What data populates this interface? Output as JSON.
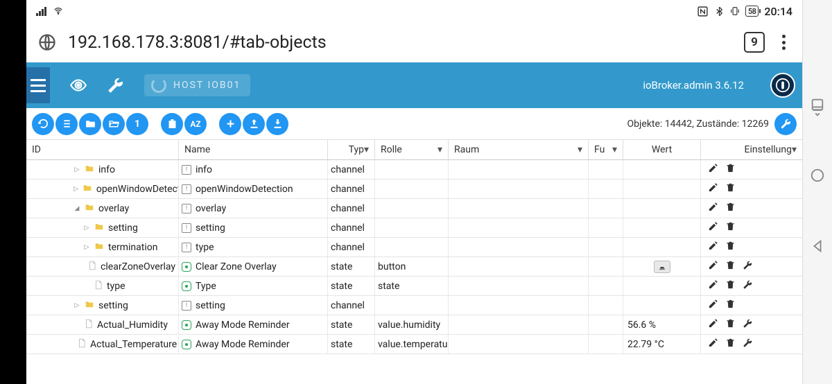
{
  "status_bar": {
    "battery": "58",
    "time": "20:14"
  },
  "browser": {
    "url": "192.168.178.3:8081/#tab-objects",
    "tab_count": "9"
  },
  "app_header": {
    "host_label": "HOST IOB01",
    "title": "ioBroker.admin 3.6.12"
  },
  "toolbar": {
    "az_label": "AZ",
    "one_label": "1",
    "count_text": "Objekte: 14442, Zustände: 12269"
  },
  "columns": {
    "id": "ID",
    "name": "Name",
    "typ": "Typ",
    "rolle": "Rolle",
    "raum": "Raum",
    "funktion": "Fu",
    "wert": "Wert",
    "einstellung": "Einstellung"
  },
  "rows": [
    {
      "indent": 2,
      "expand": "▷",
      "kind": "folder",
      "id_label": "info",
      "name_icon": "info",
      "name": "info",
      "typ": "channel",
      "rolle": "",
      "wert": "",
      "wrench": false
    },
    {
      "indent": 2,
      "expand": "▷",
      "kind": "folder",
      "id_label": "openWindowDetection",
      "name_icon": "info",
      "name": "openWindowDetection",
      "typ": "channel",
      "rolle": "",
      "wert": "",
      "wrench": false
    },
    {
      "indent": 2,
      "expand": "⊿",
      "kind": "folder",
      "id_label": "overlay",
      "name_icon": "info",
      "name": "overlay",
      "typ": "channel",
      "rolle": "",
      "wert": "",
      "wrench": false
    },
    {
      "indent": 3,
      "expand": "▷",
      "kind": "folder",
      "id_label": "setting",
      "name_icon": "info",
      "name": "setting",
      "typ": "channel",
      "rolle": "",
      "wert": "",
      "wrench": false
    },
    {
      "indent": 3,
      "expand": "▷",
      "kind": "folder",
      "id_label": "termination",
      "name_icon": "info",
      "name": "type",
      "typ": "channel",
      "rolle": "",
      "wert": "",
      "wrench": false
    },
    {
      "indent": 3,
      "expand": "",
      "kind": "file",
      "id_label": "clearZoneOverlay",
      "name_icon": "state",
      "name": "Clear Zone Overlay",
      "typ": "state",
      "rolle": "button",
      "wert": "",
      "wert_icon": true,
      "wrench": true
    },
    {
      "indent": 3,
      "expand": "",
      "kind": "file",
      "id_label": "type",
      "name_icon": "state",
      "name": "Type",
      "typ": "state",
      "rolle": "state",
      "wert": "",
      "wrench": true
    },
    {
      "indent": 2,
      "expand": "▷",
      "kind": "folder",
      "id_label": "setting",
      "name_icon": "info",
      "name": "setting",
      "typ": "channel",
      "rolle": "",
      "wert": "",
      "wrench": false
    },
    {
      "indent": 2,
      "expand": "",
      "kind": "file",
      "id_label": "Actual_Humidity",
      "name_icon": "state",
      "name": "Away Mode Reminder",
      "typ": "state",
      "rolle": "value.humidity",
      "wert": "56.6 %",
      "wrench": true
    },
    {
      "indent": 2,
      "expand": "",
      "kind": "file",
      "id_label": "Actual_Temperature",
      "name_icon": "state",
      "name": "Away Mode Reminder",
      "typ": "state",
      "rolle": "value.temperatu",
      "wert": "22.79 °C",
      "wrench": true
    }
  ]
}
